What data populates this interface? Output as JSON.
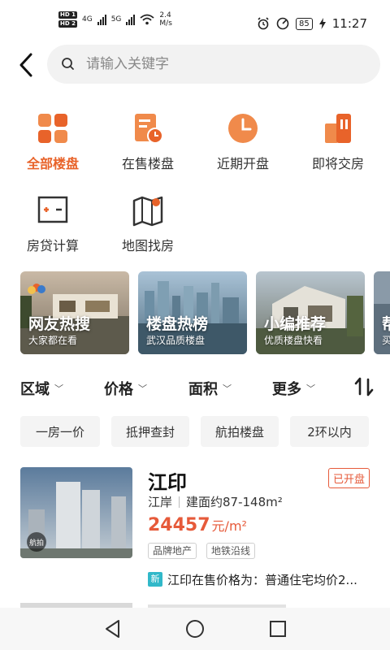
{
  "status_bar": {
    "hd1": "HD 1",
    "hd2": "HD 2",
    "net1": "4G",
    "net2": "5G",
    "speed_value": "2.4",
    "speed_unit": "M/s",
    "battery": "85",
    "time": "11:27"
  },
  "search": {
    "placeholder": "请输入关键字"
  },
  "quick_menu": [
    {
      "label": "全部楼盘",
      "icon": "grid-squares-icon",
      "active": true
    },
    {
      "label": "在售楼盘",
      "icon": "document-clock-icon",
      "active": false
    },
    {
      "label": "近期开盘",
      "icon": "clock-icon",
      "active": false
    },
    {
      "label": "即将交房",
      "icon": "building-icon",
      "active": false
    },
    {
      "label": "房贷计算",
      "icon": "calculator-icon",
      "active": false
    },
    {
      "label": "地图找房",
      "icon": "map-pin-icon",
      "active": false
    }
  ],
  "banners": [
    {
      "title": "网友热搜",
      "subtitle": "大家都在看"
    },
    {
      "title": "楼盘热榜",
      "subtitle": "武汉品质楼盘"
    },
    {
      "title": "小编推荐",
      "subtitle": "优质楼盘快看"
    },
    {
      "title": "帮",
      "subtitle": "买"
    }
  ],
  "filters": {
    "region": "区域",
    "price": "价格",
    "area": "面积",
    "more": "更多"
  },
  "tags": [
    "一房一价",
    "抵押查封",
    "航拍楼盘",
    "2环以内"
  ],
  "listing": {
    "name": "江印",
    "status": "已开盘",
    "district": "江岸",
    "area": "建面约87-148m²",
    "price": "24457",
    "price_unit": "元/m²",
    "tags": [
      "品牌地产",
      "地铁沿线"
    ],
    "aerial_label": "航拍",
    "news_badge": "新",
    "news_text": "江印在售价格为：普通住宅均价2..."
  },
  "colors": {
    "accent": "#e8632a",
    "price": "#e65a3a",
    "news": "#31b8c9"
  }
}
